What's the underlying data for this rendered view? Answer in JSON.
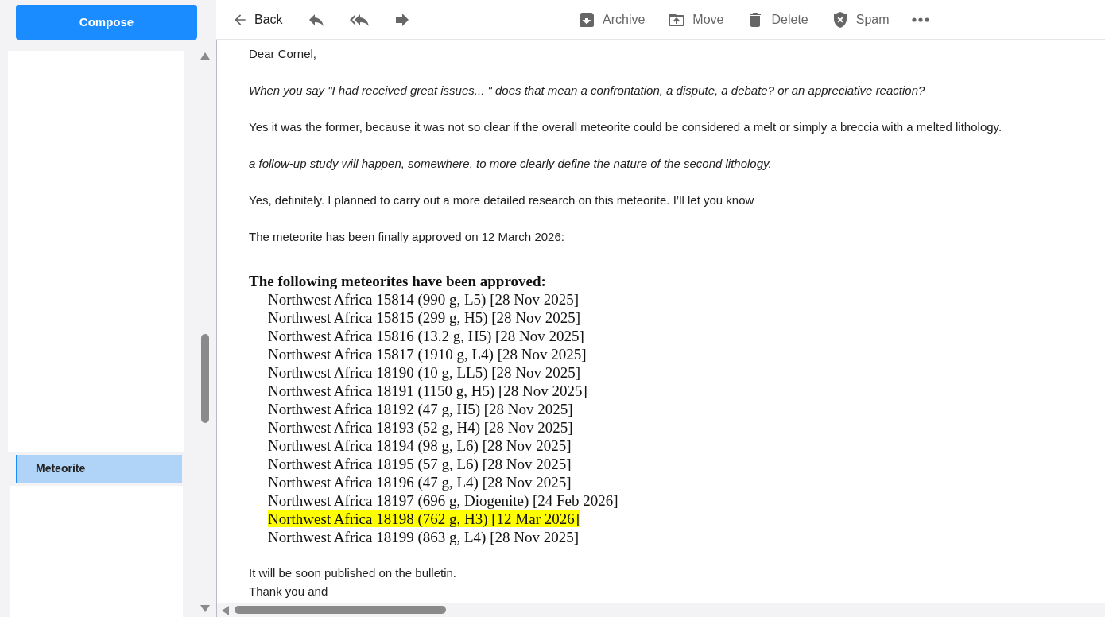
{
  "compose": {
    "label": "Compose"
  },
  "folders": [
    {
      "label": "Meteorite",
      "selected": true
    }
  ],
  "toolbar": {
    "left": [
      {
        "kind": "back",
        "label": "Back"
      },
      {
        "kind": "reply"
      },
      {
        "kind": "reply-all"
      },
      {
        "kind": "forward"
      }
    ],
    "right": [
      {
        "kind": "archive",
        "label": "Archive"
      },
      {
        "kind": "move",
        "label": "Move"
      },
      {
        "kind": "delete",
        "label": "Delete"
      },
      {
        "kind": "spam",
        "label": "Spam"
      },
      {
        "kind": "more"
      }
    ]
  },
  "message": {
    "blocks": [
      {
        "kind": "para",
        "text": "Dear Cornel,",
        "italic": false
      },
      {
        "kind": "para",
        "text": "When you say \"I had received great issues... \"  does that mean a confrontation, a dispute, a debate? or an appreciative reaction?",
        "italic": true
      },
      {
        "kind": "para",
        "text": "Yes it was the former, because it was not so clear if the overall meteorite could be considered a melt or simply a breccia with a melted lithology.",
        "italic": false
      },
      {
        "kind": "para",
        "text": "a follow-up study will happen, somewhere, to more clearly define the nature of the second lithology.",
        "italic": true
      },
      {
        "kind": "para",
        "text": "Yes, definitely. I planned to carry out a more detailed research on this meteorite. I’ll let you know",
        "italic": false
      },
      {
        "kind": "para",
        "text": "The meteorite has been finally approved on 12 March 2026:",
        "italic": false
      },
      {
        "kind": "list",
        "heading": "The following meteorites have been approved:",
        "items": [
          {
            "text": "Northwest Africa 15814 (990 g, L5) [28 Nov 2025]",
            "highlighted": false
          },
          {
            "text": "Northwest Africa 15815 (299 g, H5) [28 Nov 2025]",
            "highlighted": false
          },
          {
            "text": "Northwest Africa 15816 (13.2 g, H5) [28 Nov 2025]",
            "highlighted": false
          },
          {
            "text": "Northwest Africa 15817 (1910 g, L4) [28 Nov 2025]",
            "highlighted": false
          },
          {
            "text": "Northwest Africa 18190 (10 g, LL5) [28 Nov 2025]",
            "highlighted": false
          },
          {
            "text": "Northwest Africa 18191 (1150 g, H5) [28 Nov 2025]",
            "highlighted": false
          },
          {
            "text": "Northwest Africa 18192 (47 g, H5) [28 Nov 2025]",
            "highlighted": false
          },
          {
            "text": "Northwest Africa 18193 (52 g, H4) [28 Nov 2025]",
            "highlighted": false
          },
          {
            "text": "Northwest Africa 18194 (98 g, L6) [28 Nov 2025]",
            "highlighted": false
          },
          {
            "text": "Northwest Africa 18195 (57 g, L6) [28 Nov 2025]",
            "highlighted": false
          },
          {
            "text": "Northwest Africa 18196 (47 g, L4) [28 Nov 2025]",
            "highlighted": false
          },
          {
            "text": "Northwest Africa 18197 (696 g, Diogenite) [24 Feb 2026]",
            "highlighted": false
          },
          {
            "text": "Northwest Africa 18198 (762 g, H3) [12 Mar 2026]",
            "highlighted": true
          },
          {
            "text": "Northwest Africa 18199 (863 g, L4) [28 Nov 2025]",
            "highlighted": false
          }
        ]
      },
      {
        "kind": "lines",
        "lines": [
          "It will be soon published on the bulletin.",
          "Thank you and"
        ]
      }
    ]
  }
}
